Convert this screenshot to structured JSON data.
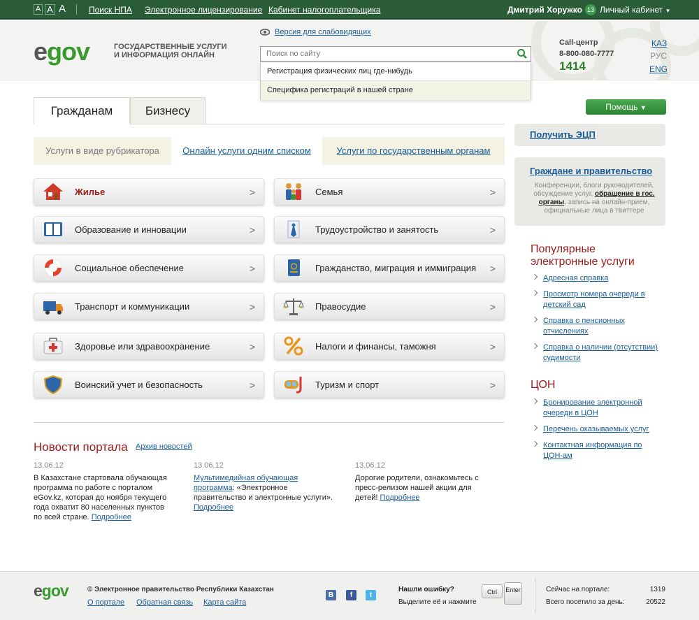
{
  "topbar": {
    "font_sizes": [
      "A",
      "A",
      "A"
    ],
    "links": [
      "Поиск НПА",
      "Электронное лицензирование",
      "Кабинет налогоплательщика"
    ],
    "user_name": "Дмитрий Хоружко",
    "badge_count": "13",
    "cabinet": "Личный кабинет"
  },
  "header": {
    "logo_e": "e",
    "logo_gov": "gov",
    "tagline_1": "ГОСУДАРСТВЕННЫЕ УСЛУГИ",
    "tagline_2": "И ИНФОРМАЦИЯ ОНЛАЙН",
    "low_vision": "Версия для слабовидящих",
    "search_placeholder": "Поиск по сайту",
    "suggestions": [
      "Регистрация физических лиц где-нибудь",
      "Специфика регистраций в нашей стране"
    ],
    "callcenter_label": "Call-центр",
    "callcenter_phone": "8-800-080-7777",
    "short_number": "1414",
    "languages": [
      "КАЗ",
      "РУС",
      "ENG"
    ]
  },
  "tabs": [
    "Гражданам",
    "Бизнесу"
  ],
  "subnav": [
    "Услуги в виде рубрикатора",
    "Онлайн услуги одним списком",
    "Услуги по государственным органам"
  ],
  "categories_left": [
    {
      "label": "Жилье",
      "icon": "house-icon"
    },
    {
      "label": "Образование и инновации",
      "icon": "book-icon"
    },
    {
      "label": "Социальное обеспечение",
      "icon": "lifebuoy-icon"
    },
    {
      "label": "Транспорт и коммуникации",
      "icon": "truck-icon"
    },
    {
      "label": "Здоровье или здравоохранение",
      "icon": "first-aid-icon"
    },
    {
      "label": "Воинский учет и безопасность",
      "icon": "shield-icon"
    }
  ],
  "categories_right": [
    {
      "label": "Семья",
      "icon": "family-icon"
    },
    {
      "label": "Трудоустройство и занятость",
      "icon": "tie-icon"
    },
    {
      "label": "Гражданство, миграция и иммиграция",
      "icon": "passport-icon"
    },
    {
      "label": "Правосудие",
      "icon": "scales-icon"
    },
    {
      "label": "Налоги и финансы, таможня",
      "icon": "percent-icon"
    },
    {
      "label": "Туризм и спорт",
      "icon": "diving-mask-icon"
    }
  ],
  "chevron": ">",
  "news": {
    "title": "Новости портала",
    "archive": "Архив новостей",
    "items": [
      {
        "date": "13.06.12",
        "link": "",
        "text": "В Казахстане стартовала обучающая программа по работе с порталом eGov.kz, которая до ноября текущего года охватит 80 населенных пунктов по всей стране.",
        "more": "Подробнее"
      },
      {
        "date": "13.06.12",
        "link": "Мультимедийная обучающая программа",
        "text": ": «Электронное правительство и электронные услуги».",
        "more": "Подробнее"
      },
      {
        "date": "13.06.12",
        "link": "",
        "text": "Дорогие родители, ознакомьтесь с пресс-релизом нашей акции для детей!",
        "more": "Подробнее"
      }
    ]
  },
  "sidebar": {
    "help": "Помощь",
    "ecp": "Получить ЭЦП",
    "gov_title": "Граждане и правительство",
    "gov_text_1": "Конференции, блоги руководителей, обсуждение услуг,",
    "gov_link": "обращение в гос. органы",
    "gov_text_2": ", запись на онлайн-прием, официальные лица в твиттере",
    "popular_title": "Популярные электронные услуги",
    "popular": [
      "Адресная справка",
      "Просмотр номера очереди в детский сад",
      "Справка о пенсионных отчислениях",
      "Справка о наличии (отсутствии) судимости"
    ],
    "con_title": "ЦОН",
    "con": [
      "Бронирование электронной очереди в ЦОН",
      "Перечень оказываемых услуг",
      "Контактная информация по ЦОН-ам"
    ]
  },
  "footer": {
    "copyright": "© Электронное правительство Республики Казахстан",
    "links": [
      "О портале",
      "Обратная связь",
      "Карта сайта"
    ],
    "social": [
      "B",
      "f",
      "t"
    ],
    "error_title": "Нашли ошибку?",
    "error_text": "Выделите её и нажмите",
    "key_ctrl": "Ctrl",
    "key_enter": "Enter",
    "now_label": "Сейчас на портале:",
    "now_value": "1319",
    "day_label": "Всего посетило за день:",
    "day_value": "20522"
  }
}
